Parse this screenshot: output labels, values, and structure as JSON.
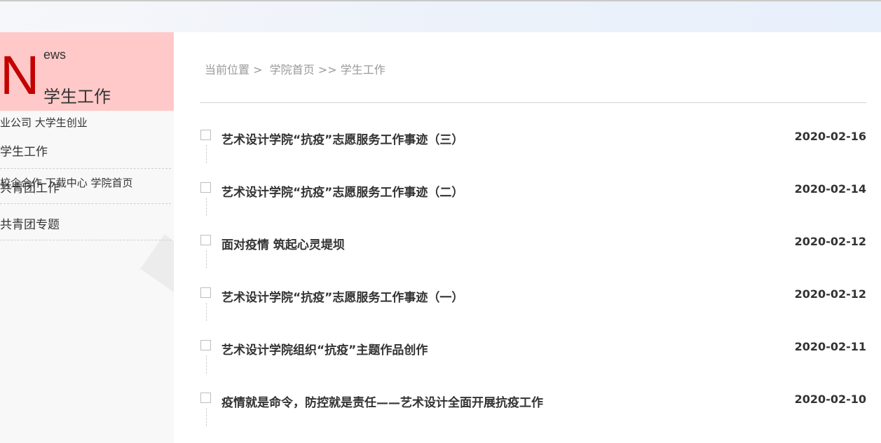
{
  "left_panel": {
    "news_letter_big": "N",
    "news_letter_rest": "ews",
    "section_title": "学生工作",
    "overflow_links_top": "业公司 大学生创业",
    "overflow_links_mid": "校企合作  下载中心  学院首页",
    "items": [
      {
        "label": "学生工作"
      },
      {
        "label": "共青团工作"
      },
      {
        "label": "共青团专题"
      }
    ]
  },
  "breadcrumb": {
    "prefix": "当前位置 >",
    "home": "学院首页",
    "sep": ">>",
    "current": "学生工作"
  },
  "news": [
    {
      "title": "艺术设计学院“抗疫”志愿服务工作事迹（三）",
      "date": "2020-02-16"
    },
    {
      "title": "艺术设计学院“抗疫”志愿服务工作事迹（二）",
      "date": "2020-02-14"
    },
    {
      "title": "面对疫情 筑起心灵堤坝",
      "date": "2020-02-12"
    },
    {
      "title": "艺术设计学院“抗疫”志愿服务工作事迹（一）",
      "date": "2020-02-12"
    },
    {
      "title": "艺术设计学院组织“抗疫”主题作品创作",
      "date": "2020-02-11"
    },
    {
      "title": "疫情就是命令，防控就是责任——艺术设计全面开展抗疫工作",
      "date": "2020-02-10"
    }
  ]
}
